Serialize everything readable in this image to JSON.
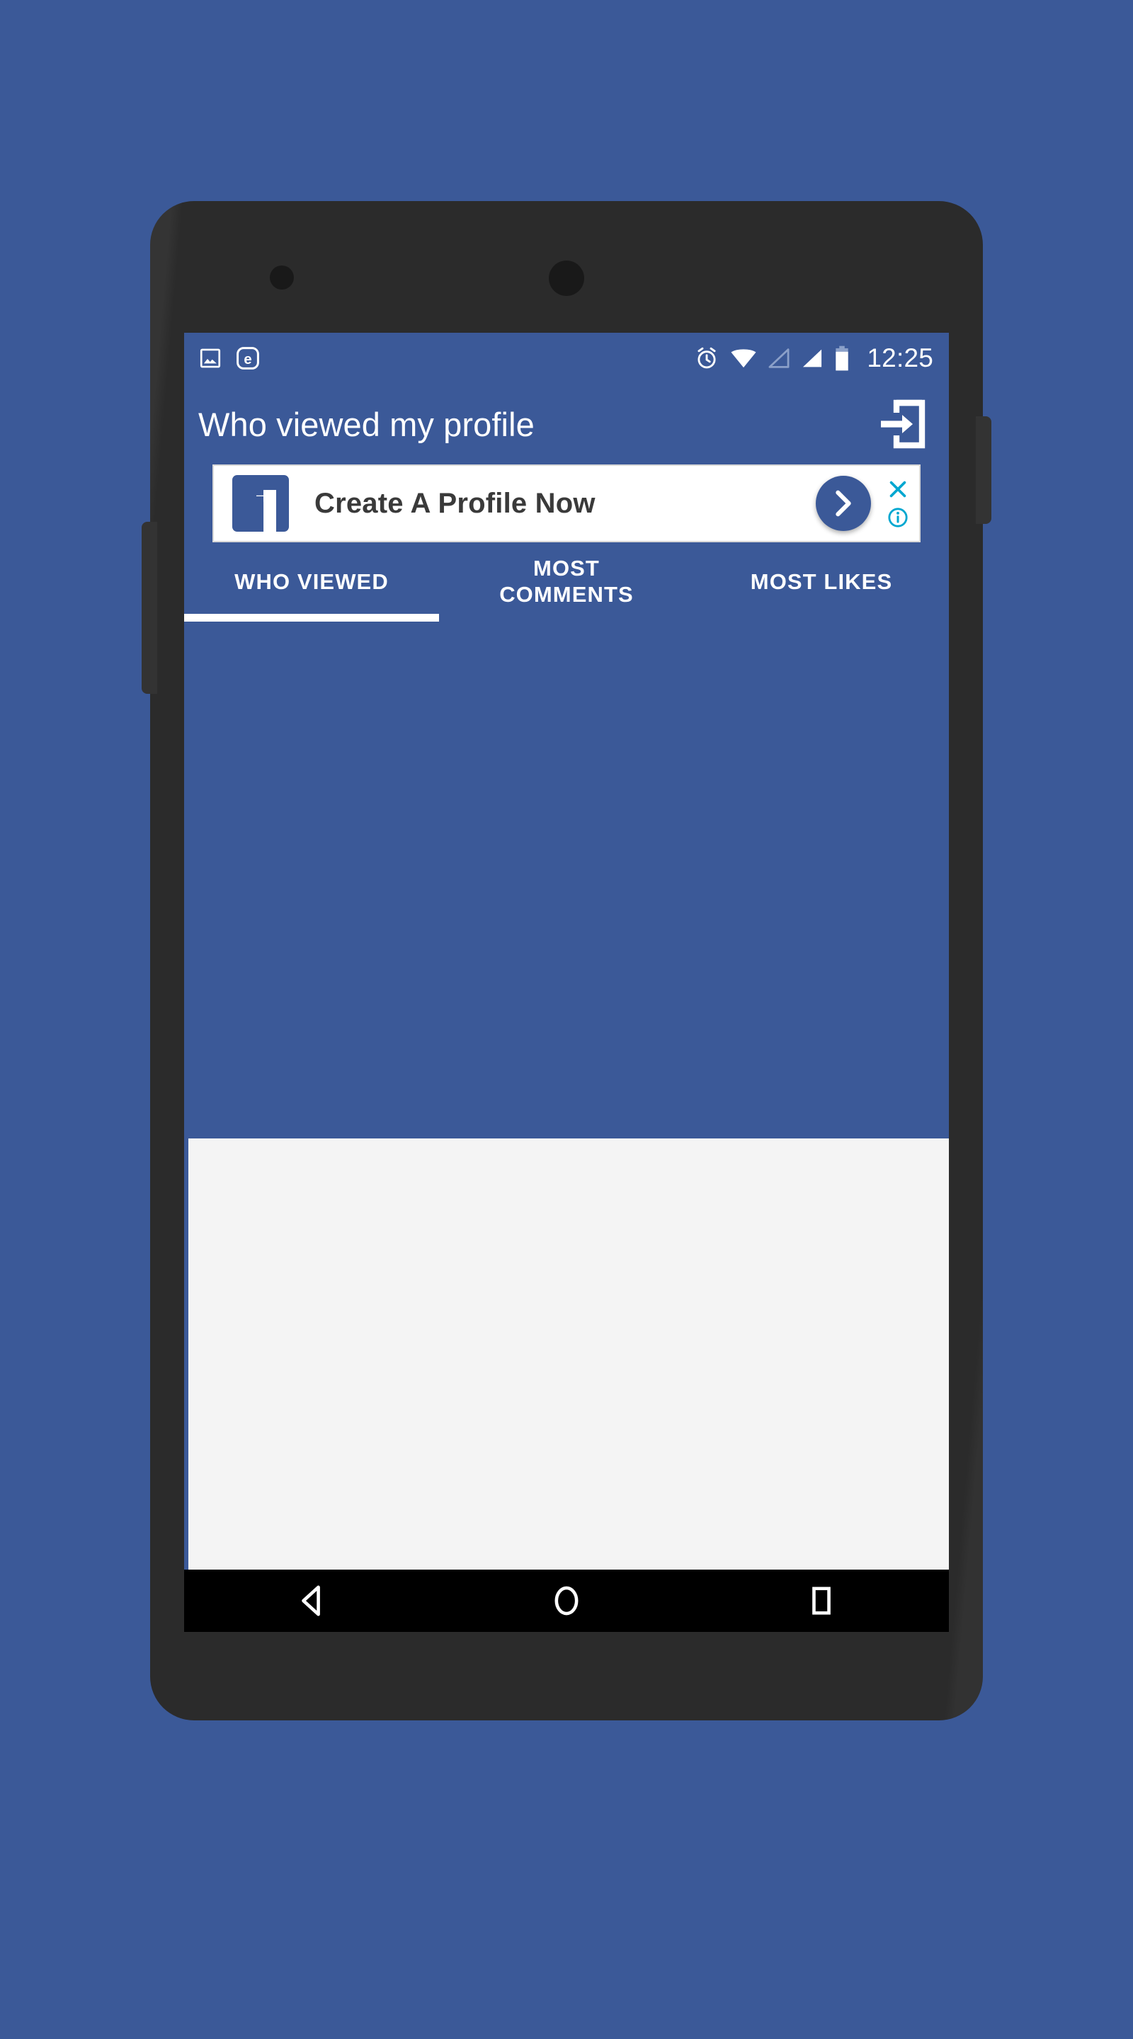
{
  "background": {
    "color": "#3b5998"
  },
  "device": {
    "name": "android-phone-mockup",
    "body_color": "#2b2b2b",
    "screen_color": "#3b5998"
  },
  "status_bar": {
    "left_icons": [
      {
        "name": "image-icon",
        "label": "Screenshot captured"
      },
      {
        "name": "edge-browser-icon",
        "label": "e"
      }
    ],
    "right_icons": [
      {
        "name": "alarm-clock-icon",
        "label": "Alarm set"
      },
      {
        "name": "wifi-icon",
        "label": "Wi-Fi connected"
      },
      {
        "name": "signal-empty-icon",
        "label": "SIM 1 no signal"
      },
      {
        "name": "signal-full-icon",
        "label": "SIM 2 full signal"
      },
      {
        "name": "battery-icon",
        "label": "Battery"
      }
    ],
    "clock": "12:25"
  },
  "app_bar": {
    "title": "Who viewed my profile",
    "action_icon": "logout-icon",
    "background": "#3b5998",
    "text_color": "#ffffff"
  },
  "ad": {
    "advertiser_icon": "facebook-logo-icon",
    "headline": "Create A Profile Now",
    "cta_icon": "chevron-right-icon",
    "close_icon": "close-icon",
    "info_icon": "ad-info-icon",
    "accent_color": "#00a7d0",
    "brand_color": "#3b5998"
  },
  "tabs": {
    "active_index": 0,
    "indicator_color": "#ffffff",
    "items": [
      {
        "label": "WHO VIEWED",
        "name": "tab-who-viewed",
        "active": true
      },
      {
        "label": "MOST\nCOMMENTS",
        "name": "tab-most-comments",
        "active": false
      },
      {
        "label": "MOST LIKES",
        "name": "tab-most-likes",
        "active": false
      }
    ]
  },
  "content": {
    "panel_color": "#f4f4f4",
    "empty": true
  },
  "nav_bar": {
    "background": "#000000",
    "buttons": [
      {
        "name": "nav-back-button",
        "icon": "back-triangle-icon"
      },
      {
        "name": "nav-home-button",
        "icon": "home-circle-icon"
      },
      {
        "name": "nav-recents-button",
        "icon": "recents-square-icon"
      }
    ]
  }
}
